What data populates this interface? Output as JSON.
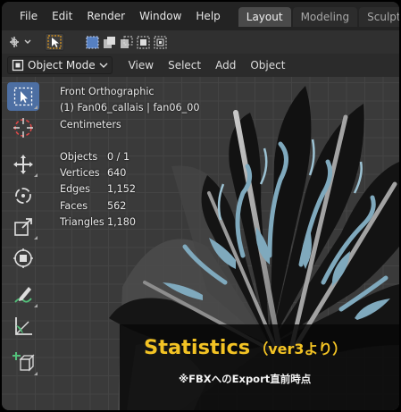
{
  "menubar": {
    "logo_icon": "blender-logo-icon",
    "items": [
      "File",
      "Edit",
      "Render",
      "Window",
      "Help"
    ],
    "workspace_tabs": [
      {
        "label": "Layout",
        "active": true
      },
      {
        "label": "Modeling",
        "active": false
      },
      {
        "label": "Sculpting",
        "active": false
      }
    ]
  },
  "tool_settings": {
    "icons": [
      "transform-pivot-icon",
      "select-tool-icon",
      "select-mode-set-icon",
      "select-mode-extend-icon",
      "select-mode-subtract-icon",
      "select-mode-invert-icon",
      "select-mode-intersect-icon"
    ]
  },
  "header": {
    "mode": "Object Mode",
    "menus": [
      "View",
      "Select",
      "Add",
      "Object"
    ]
  },
  "viewport": {
    "view_name": "Front Orthographic",
    "object_info": "(1) Fan06_callais | fan06_00",
    "units": "Centimeters",
    "statistics": [
      {
        "label": "Objects",
        "value": "0 / 1"
      },
      {
        "label": "Vertices",
        "value": "640"
      },
      {
        "label": "Edges",
        "value": "1,152"
      },
      {
        "label": "Faces",
        "value": "562"
      },
      {
        "label": "Triangles",
        "value": "1,180"
      }
    ]
  },
  "toolbar": {
    "tools": [
      "select-box-icon",
      "cursor-icon",
      "move-icon",
      "rotate-icon",
      "scale-icon",
      "transform-icon",
      "annotate-icon",
      "measure-icon",
      "add-cube-icon"
    ]
  },
  "caption": {
    "title": "Statistics",
    "subtitle": "（ver3より）",
    "note": "※FBXへのExport直前時点"
  },
  "colors": {
    "accent_blue": "#4d6fa3",
    "caption_gold": "#f3c324",
    "fan_teal": "#7fa9bd",
    "fan_dark": "#121212"
  }
}
